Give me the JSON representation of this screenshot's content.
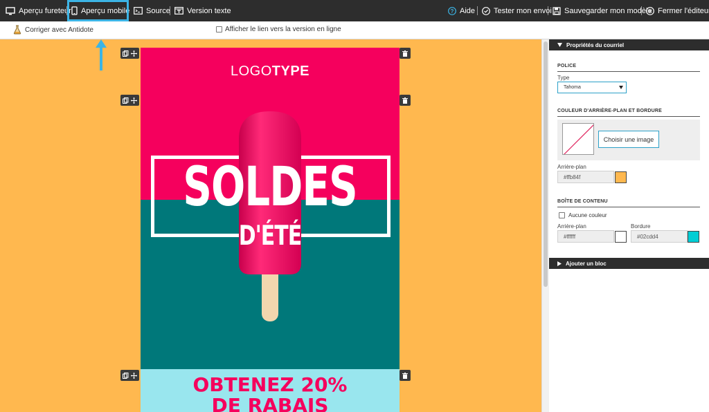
{
  "toolbar": {
    "browser_preview": "Aperçu fureteur",
    "mobile_preview": "Aperçu mobile",
    "source": "Source",
    "text_version": "Version texte",
    "help": "Aide",
    "test_send": "Tester mon envoi",
    "save_template": "Sauvegarder mon modèle",
    "close_editor": "Fermer l'éditeur"
  },
  "subbar": {
    "antidote": "Corriger avec Antidote",
    "show_online_link": "Afficher le lien vers la version en ligne"
  },
  "email": {
    "logo_light": "LOGO",
    "logo_bold": "TYPE",
    "hero_line1": "SOLDES",
    "hero_line2": "D'ÉTÉ",
    "promo_line1": "OBTENEZ 20%",
    "promo_line2": "DE RABAIS"
  },
  "panel": {
    "properties_header": "Propriétés du courriel",
    "font_section": "POLICE",
    "type_label": "Type",
    "font_value": "Tahoma",
    "bg_section": "COULEUR D'ARRIÈRE-PLAN ET BORDURE",
    "choose_image": "Choisir une image",
    "background_label": "Arrière-plan",
    "background_value": "#ffb84f",
    "content_section": "BOÎTE DE CONTENU",
    "no_color": "Aucune couleur",
    "content_bg_label": "Arrière-plan",
    "content_bg_value": "#ffffff",
    "border_label": "Bordure",
    "border_value": "#02cdd4",
    "add_block": "Ajouter un bloc"
  },
  "colors": {
    "canvas_bg": "#ffb84f",
    "content_bg": "#ffffff",
    "border": "#02cdd4",
    "highlight": "#3cb4e5",
    "pink": "#f5005d",
    "teal": "#00787a"
  }
}
